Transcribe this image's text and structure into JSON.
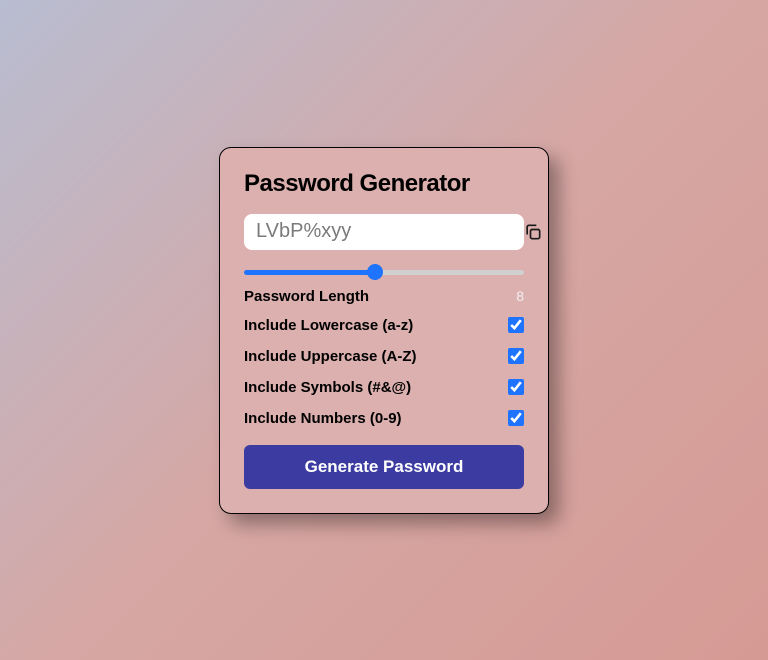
{
  "title": "Password Generator",
  "generatedPassword": "LVbP%xyy",
  "slider": {
    "min": 1,
    "max": 16,
    "value": 8
  },
  "lengthLabel": "Password Length",
  "lengthValue": "8",
  "options": {
    "lowercase": {
      "label": "Include Lowercase (a-z)",
      "checked": true
    },
    "uppercase": {
      "label": "Include Uppercase (A-Z)",
      "checked": true
    },
    "symbols": {
      "label": "Include Symbols (#&@)",
      "checked": true
    },
    "numbers": {
      "label": "Include Numbers (0-9)",
      "checked": true
    }
  },
  "generateLabel": "Generate Password",
  "icons": {
    "copy": "copy-icon"
  },
  "colors": {
    "accent": "#1e73ff",
    "buttonBg": "#3b3ba1"
  }
}
